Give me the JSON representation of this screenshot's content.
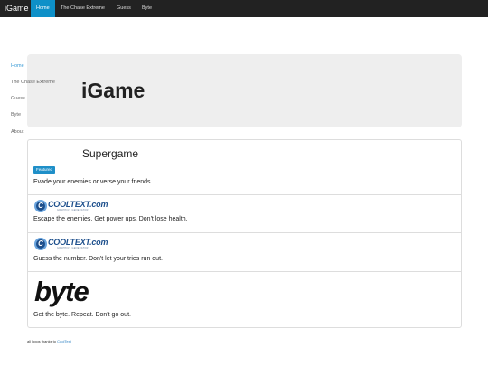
{
  "navbar": {
    "brand": "iGame",
    "items": [
      {
        "label": "Home",
        "active": true
      },
      {
        "label": "The Chase Extreme",
        "active": false
      },
      {
        "label": "Guess",
        "active": false
      },
      {
        "label": "Byte",
        "active": false
      }
    ]
  },
  "sidebar": {
    "items": [
      {
        "label": "Home",
        "active": true
      },
      {
        "label": "The Chase Extreme",
        "active": false
      },
      {
        "label": "Guess",
        "active": false
      },
      {
        "label": "Byte",
        "active": false
      },
      {
        "label": "About",
        "active": false
      }
    ]
  },
  "jumbotron": {
    "title": "iGame"
  },
  "games": {
    "supergame": {
      "title": "Supergame",
      "badge": "Featured",
      "description": "Evade your enemies or verse your friends."
    },
    "chase": {
      "logo_text": "COOLTEXT.com",
      "logo_letter": "C",
      "logo_subtext": "GRAPHICS GENERATOR",
      "description": "Escape the enemies. Get power ups. Don't lose health."
    },
    "guess": {
      "logo_text": "COOLTEXT.com",
      "logo_letter": "C",
      "logo_subtext": "GRAPHICS GENERATOR",
      "description": "Guess the number. Don't let your tries run out."
    },
    "byte": {
      "logo_text": "byte",
      "description": "Get the byte. Repeat. Don't go out."
    }
  },
  "footer": {
    "text": "all logos thanks to",
    "link": "CoolText"
  },
  "colors": {
    "navbar_bg": "#222222",
    "accent": "#0e90c8",
    "jumbotron_bg": "#eeeeee",
    "cooltext_blue": "#1d4f8c"
  }
}
